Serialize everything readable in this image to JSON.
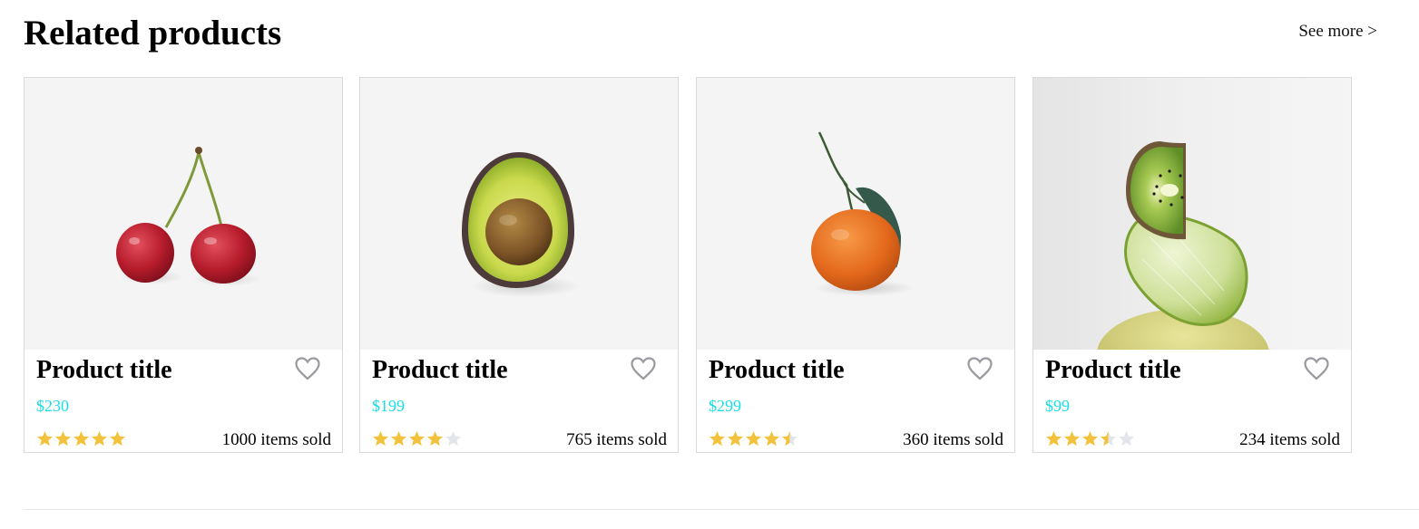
{
  "section": {
    "title": "Related products",
    "see_more_label": "See more >"
  },
  "colors": {
    "price": "#17e0e8",
    "star_filled": "#f3c23d",
    "star_empty": "#e2e5ea",
    "heart_outline": "#9a9aa0"
  },
  "products": [
    {
      "title": "Product title",
      "price": "$230",
      "rating": 5,
      "sold": "1000 items sold",
      "image": "cherries",
      "icon": "heart-outline-icon"
    },
    {
      "title": "Product title",
      "price": "$199",
      "rating": 4,
      "sold": "765 items sold",
      "image": "avocado",
      "icon": "heart-outline-icon"
    },
    {
      "title": "Product title",
      "price": "$299",
      "rating": 4.5,
      "sold": "360 items sold",
      "image": "orange",
      "icon": "heart-outline-icon"
    },
    {
      "title": "Product title",
      "price": "$99",
      "rating": 3.5,
      "sold": "234 items sold",
      "image": "kiwi-lime",
      "icon": "heart-outline-icon"
    }
  ]
}
